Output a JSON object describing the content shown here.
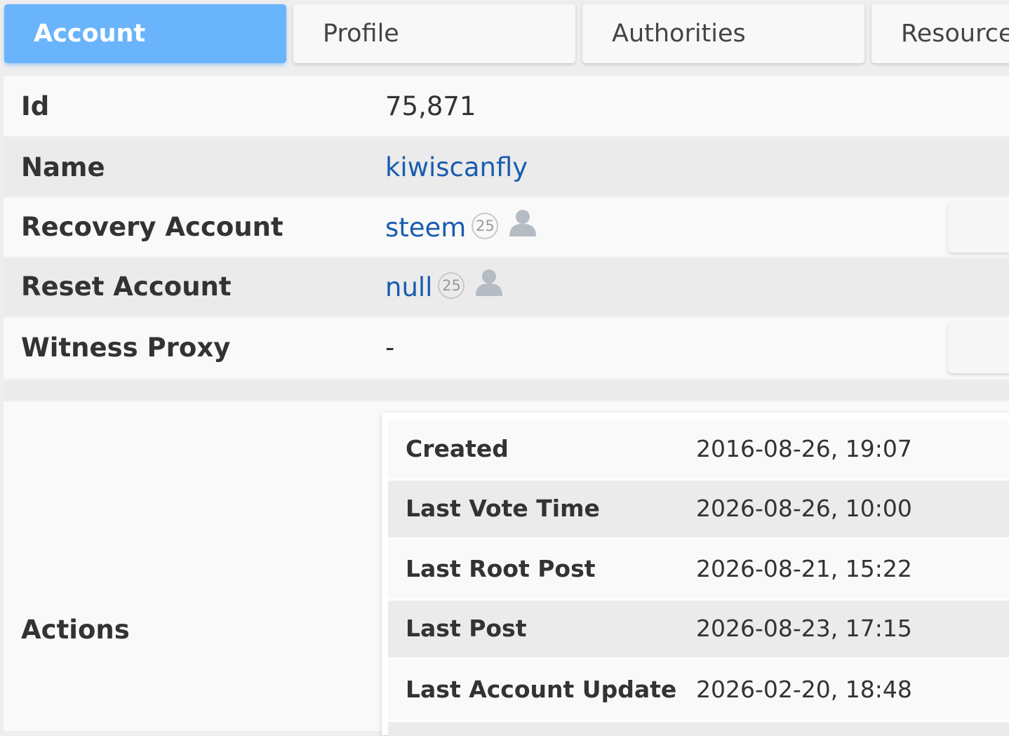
{
  "tabs": {
    "account": "Account",
    "profile": "Profile",
    "authorities": "Authorities",
    "resources": "Resources"
  },
  "account": {
    "id_label": "Id",
    "id_value": "75,871",
    "name_label": "Name",
    "name_value": "kiwiscanfly",
    "recovery_label": "Recovery Account",
    "recovery_value": "steem",
    "recovery_rep": "25",
    "reset_label": "Reset Account",
    "reset_value": "null",
    "reset_rep": "25",
    "witness_proxy_label": "Witness Proxy",
    "witness_proxy_value": "-",
    "actions_label": "Actions"
  },
  "actions": {
    "created_label": "Created",
    "created_value": "2016-08-26, 19:07",
    "last_vote_label": "Last Vote Time",
    "last_vote_value": "2026-08-26, 10:00",
    "last_root_post_label": "Last Root Post",
    "last_root_post_value": "2026-08-21, 15:22",
    "last_post_label": "Last Post",
    "last_post_value": "2026-08-23, 17:15",
    "last_account_update_label": "Last Account Update",
    "last_account_update_value": "2026-02-20, 18:48"
  },
  "colors": {
    "tab_active": "#6ab4fb",
    "link": "#1a5cb0"
  }
}
